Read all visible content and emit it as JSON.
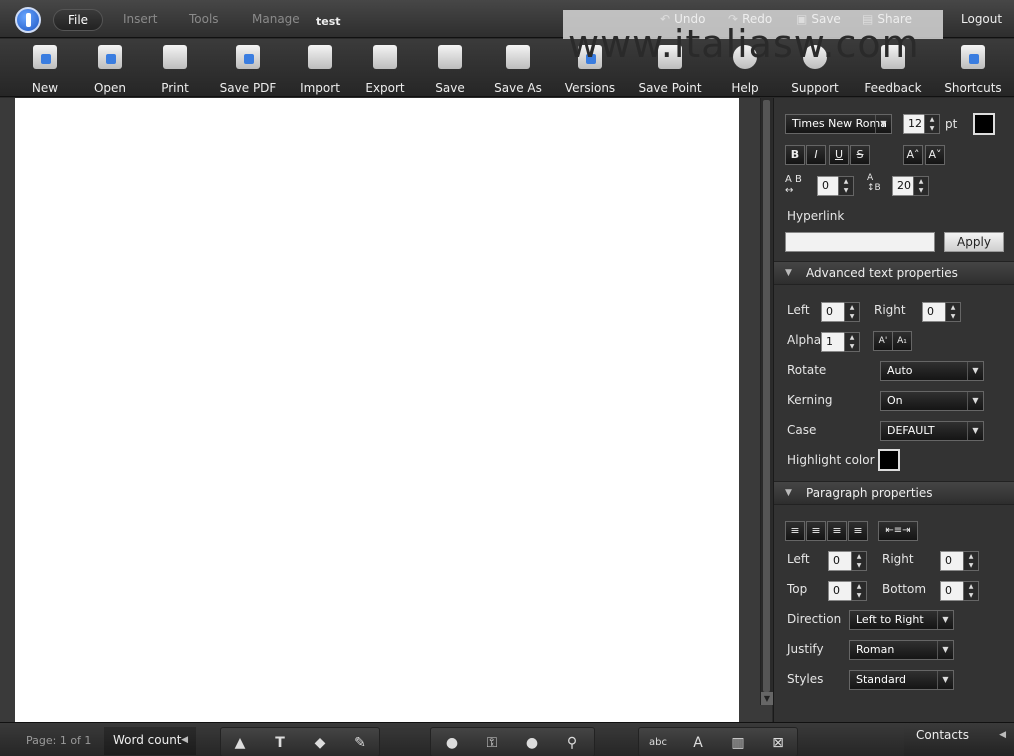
{
  "menu": {
    "file": "File",
    "insert": "Insert",
    "tools": "Tools",
    "manage": "Manage",
    "doc_name": "test"
  },
  "top_actions": {
    "undo": "Undo",
    "redo": "Redo",
    "save": "Save",
    "share": "Share",
    "logout": "Logout"
  },
  "watermark": "www.italiasw.com",
  "toolbar": {
    "new": "New",
    "open": "Open",
    "print": "Print",
    "save_pdf": "Save PDF",
    "import": "Import",
    "export": "Export",
    "save": "Save",
    "save_as": "Save As",
    "versions": "Versions",
    "save_point": "Save Point",
    "help": "Help",
    "support": "Support",
    "feedback": "Feedback",
    "shortcuts": "Shortcuts"
  },
  "text_props": {
    "font": "Times New Roma",
    "size": "12",
    "size_unit": "pt",
    "bold": "B",
    "italic": "I",
    "underline": "U",
    "strike": "S",
    "char_spacing": "0",
    "line_spacing": "20",
    "hyperlink_label": "Hyperlink",
    "hyperlink_value": "",
    "apply": "Apply"
  },
  "advanced": {
    "title": "Advanced text properties",
    "left_label": "Left",
    "left_value": "0",
    "right_label": "Right",
    "right_value": "0",
    "alpha_label": "Alpha",
    "alpha_value": "1",
    "rotate_label": "Rotate",
    "rotate_value": "Auto",
    "kerning_label": "Kerning",
    "kerning_value": "On",
    "case_label": "Case",
    "case_value": "DEFAULT",
    "highlight_label": "Highlight color"
  },
  "paragraph": {
    "title": "Paragraph properties",
    "left_label": "Left",
    "left_value": "0",
    "right_label": "Right",
    "right_value": "0",
    "top_label": "Top",
    "top_value": "0",
    "bottom_label": "Bottom",
    "bottom_value": "0",
    "direction_label": "Direction",
    "direction_value": "Left to Right",
    "justify_label": "Justify",
    "justify_value": "Roman",
    "styles_label": "Styles",
    "styles_value": "Standard"
  },
  "status": {
    "page_info": "Page: 1 of 1",
    "word_count": "Word count",
    "contacts": "Contacts"
  }
}
